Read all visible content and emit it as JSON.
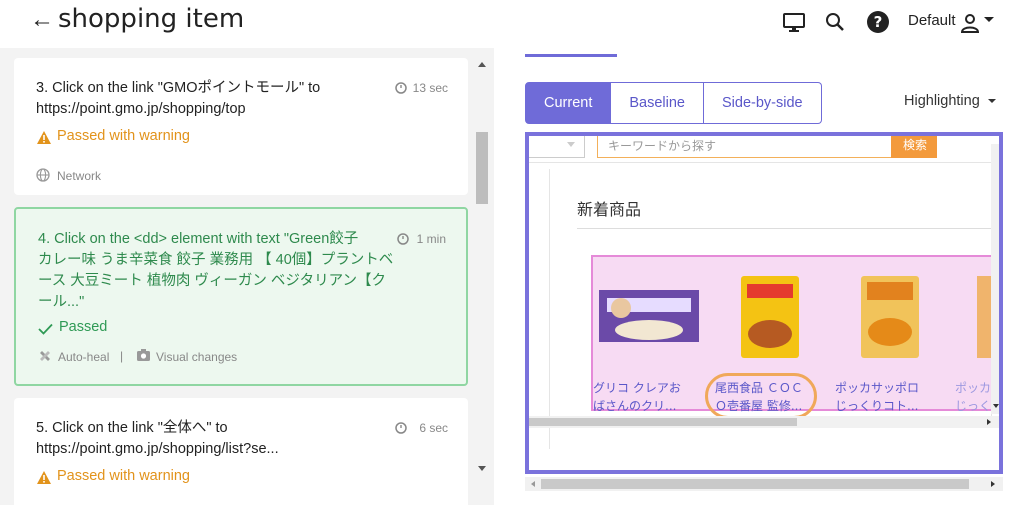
{
  "header": {
    "back_glyph": "←",
    "title": "shopping item",
    "account_label": "Default"
  },
  "steps": [
    {
      "text_line1": "3. Click on the link \"GMOポイントモール\" to",
      "text_line2": "https://point.gmo.jp/shopping/top",
      "time": "13 sec",
      "status": "Passed with warning",
      "meta": "Network"
    },
    {
      "text_line1": "4. Click on the <dd> element with text \"Green餃子",
      "text_line2": "カレー味 うま辛菜食 餃子 業務用 【 40個】プラントベ",
      "text_line3": "ース 大豆ミート 植物肉 ヴィーガン ベジタリアン【ク",
      "text_line4": "ール...\"",
      "time": "1 min",
      "status": "Passed",
      "meta_heal": "Auto-heal",
      "meta_sep": "|",
      "meta_visual": "Visual changes"
    },
    {
      "text_line1": "5. Click on the link \"全体へ\" to",
      "text_line2": "https://point.gmo.jp/shopping/list?se...",
      "time": "6 sec",
      "status": "Passed with warning"
    }
  ],
  "view_tabs": [
    "Current",
    "Baseline",
    "Side-by-side"
  ],
  "highlighting_label": "Highlighting",
  "screenshot": {
    "search_placeholder": "キーワードから探す",
    "search_button": "検索",
    "section_title": "新着商品",
    "products": [
      {
        "line1": "グリコ クレアお",
        "line2": "ばさんのクリ..."
      },
      {
        "line1": "尾西食品 ＣＯＣ",
        "line2": "Ｏ壱番屋 監修..."
      },
      {
        "line1": "ポッカサッポロ",
        "line2": "じっくりコト..."
      },
      {
        "line1": "ポッカ",
        "line2": "じっく"
      }
    ]
  },
  "colors": {
    "accent": "#6f6bd8",
    "warning": "#e2931b",
    "passed": "#2f9a55",
    "highlight_fill": "#f7dbf3",
    "highlight_border": "#e58ad8",
    "focus_ring": "#f0a85a"
  }
}
